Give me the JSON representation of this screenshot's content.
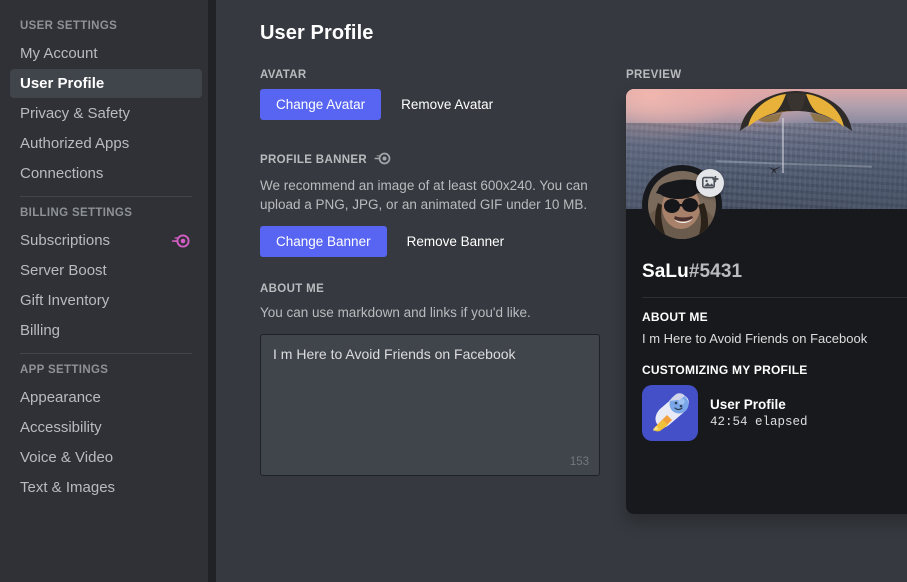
{
  "sidebar": {
    "groups": [
      {
        "header": "USER SETTINGS",
        "items": [
          {
            "label": "My Account",
            "selected": false,
            "badge": null
          },
          {
            "label": "User Profile",
            "selected": true,
            "badge": null
          },
          {
            "label": "Privacy & Safety",
            "selected": false,
            "badge": null
          },
          {
            "label": "Authorized Apps",
            "selected": false,
            "badge": null
          },
          {
            "label": "Connections",
            "selected": false,
            "badge": null
          }
        ]
      },
      {
        "header": "BILLING SETTINGS",
        "items": [
          {
            "label": "Subscriptions",
            "selected": false,
            "badge": "nitro-icon"
          },
          {
            "label": "Server Boost",
            "selected": false,
            "badge": null
          },
          {
            "label": "Gift Inventory",
            "selected": false,
            "badge": null
          },
          {
            "label": "Billing",
            "selected": false,
            "badge": null
          }
        ]
      },
      {
        "header": "APP SETTINGS",
        "items": [
          {
            "label": "Appearance",
            "selected": false,
            "badge": null
          },
          {
            "label": "Accessibility",
            "selected": false,
            "badge": null
          },
          {
            "label": "Voice & Video",
            "selected": false,
            "badge": null
          },
          {
            "label": "Text & Images",
            "selected": false,
            "badge": null
          }
        ]
      }
    ]
  },
  "main": {
    "title": "User Profile",
    "avatar_section": {
      "label": "AVATAR",
      "change_label": "Change Avatar",
      "remove_label": "Remove Avatar"
    },
    "banner_section": {
      "label": "PROFILE BANNER",
      "label_badge": "nitro-icon",
      "description": "We recommend an image of at least 600x240. You can upload a PNG, JPG, or an animated GIF under 10 MB.",
      "change_label": "Change Banner",
      "remove_label": "Remove Banner"
    },
    "about_section": {
      "label": "ABOUT ME",
      "hint": "You can use markdown and links if you'd like.",
      "value": "I m Here to Avoid Friends on Facebook",
      "placeholder": "",
      "char_count": "153"
    }
  },
  "preview": {
    "label": "PREVIEW",
    "banner_alt": "skydiver-with-yellow-black-parachute-over-city",
    "nitro_badge": "nitro-icon",
    "avatar_alt": "person-in-hat-and-sunglasses",
    "avatar_edit_icon": "add-image-icon",
    "username": "SaLu",
    "discriminator": "#5431",
    "about_title": "ABOUT ME",
    "about_text": "I m Here to Avoid Friends on Facebook",
    "activity_title": "CUSTOMIZING MY PROFILE",
    "activity": {
      "icon": "rocket-icon",
      "name": "User Profile",
      "elapsed": "42:54 elapsed"
    }
  },
  "colors": {
    "accent": "#5865f2",
    "sidebar_bg": "#2f3136",
    "content_bg": "#36393f",
    "card_bg": "#18191c",
    "nitro_pink": "#d45ec4"
  }
}
